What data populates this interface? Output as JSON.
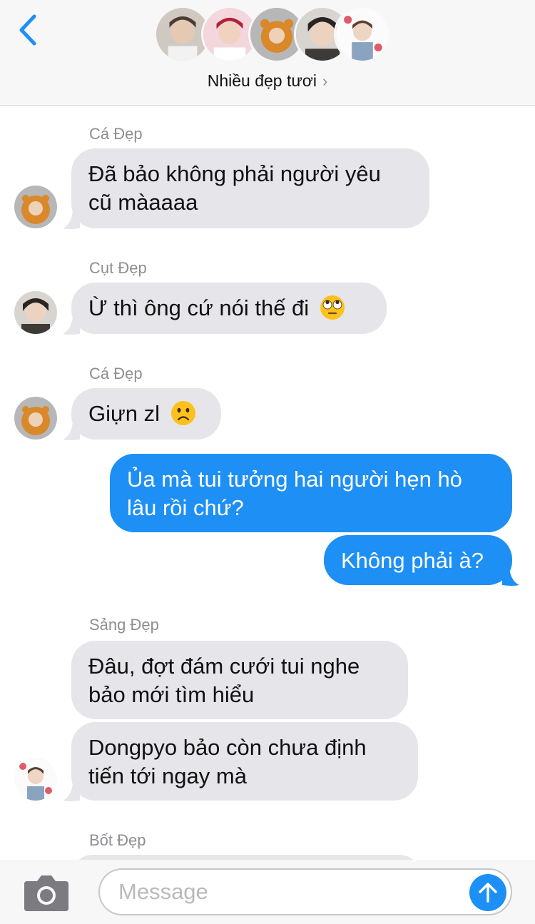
{
  "header": {
    "group_name": "Nhiều đẹp tươi",
    "back_icon": "chevron-left-icon",
    "accent": "#1d8ff5"
  },
  "messages": [
    {
      "type": "incoming",
      "sender": "Cá Đẹp",
      "lines": [
        "Đã bảo không phải người yêu",
        "cũ màaaaa"
      ]
    },
    {
      "type": "incoming",
      "sender": "Cụt Đẹp",
      "lines": [
        "Ừ thì ông cứ nói thế đi"
      ],
      "emoji": "face-with-rolling-eyes"
    },
    {
      "type": "incoming",
      "sender": "Cá Đẹp",
      "lines": [
        "Giựn zl"
      ],
      "emoji": "frowning-face"
    },
    {
      "type": "outgoing",
      "lines": [
        "Ủa mà tui tưởng hai người hẹn hò",
        "lâu rồi chứ?"
      ]
    },
    {
      "type": "outgoing",
      "lines": [
        "Không phải à?"
      ]
    },
    {
      "type": "incoming",
      "sender": "Sảng Đẹp",
      "lines": [
        "Đâu, đợt đám cưới tui nghe",
        "bảo mới tìm hiểu"
      ]
    },
    {
      "type": "incoming",
      "lines": [
        "Dongpyo bảo còn chưa định",
        "tiến tới ngay mà"
      ]
    },
    {
      "type": "incoming",
      "sender": "Bốt Đẹp",
      "lines": []
    }
  ],
  "composer": {
    "placeholder": "Message",
    "camera_icon": "camera-icon",
    "send_icon": "arrow-up-icon"
  },
  "colors": {
    "incoming_bubble": "#e5e5ea",
    "outgoing_bubble": "#1d8ff5",
    "sender_label": "#8e8e93"
  }
}
